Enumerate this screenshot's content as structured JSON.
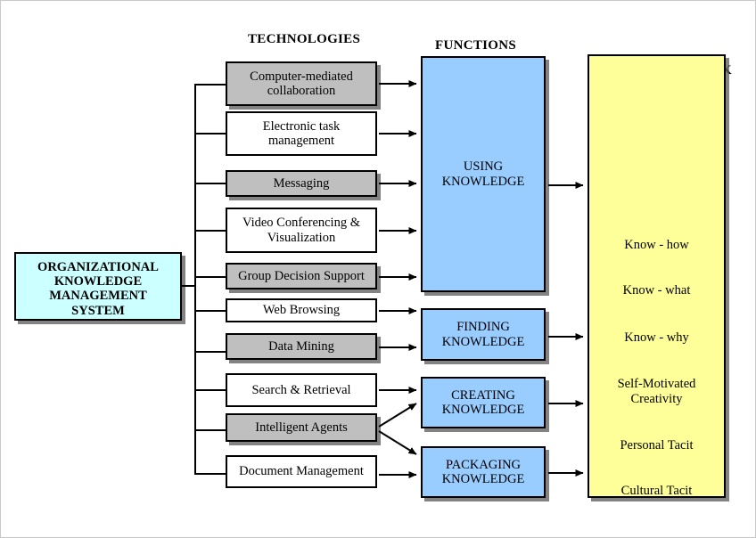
{
  "headers": {
    "technologies": "TECHNOLOGIES",
    "functions": "FUNCTIONS",
    "outcomes_clipped": "K"
  },
  "source": {
    "label_lines": [
      "ORGANIZATIONAL",
      "KNOWLEDGE",
      "MANAGEMENT",
      "SYSTEM"
    ],
    "note_last_line_clipped": "SYSTEM"
  },
  "technologies": [
    {
      "label": "Computer-mediated collaboration",
      "line1": "Computer-mediated",
      "line2": "collaboration",
      "style": "gray"
    },
    {
      "label": "Electronic task management",
      "line1": "Electronic task",
      "line2": "management",
      "style": "white"
    },
    {
      "label": "Messaging",
      "line1": "Messaging",
      "line2": "",
      "style": "gray"
    },
    {
      "label": "Video Conferencing & Visualization",
      "line1": "Video Conferencing &",
      "line2": "Visualization",
      "style": "white"
    },
    {
      "label": "Group Decision Support",
      "line1": "Group Decision Support",
      "line2": "",
      "style": "gray"
    },
    {
      "label": "Web Browsing",
      "line1": "Web Browsing",
      "line2": "",
      "style": "white"
    },
    {
      "label": "Data Mining",
      "line1": "Data Mining",
      "line2": "",
      "style": "gray"
    },
    {
      "label": "Search & Retrieval",
      "line1": "Search & Retrieval",
      "line2": "",
      "style": "white"
    },
    {
      "label": "Intelligent Agents",
      "line1": "Intelligent Agents",
      "line2": "",
      "style": "gray"
    },
    {
      "label": "Document Management",
      "line1": "Document Management",
      "line2": "",
      "style": "white"
    }
  ],
  "functions": [
    {
      "label": "USING KNOWLEDGE",
      "line1": "USING",
      "line2": "KNOWLEDGE"
    },
    {
      "label": "FINDING KNOWLEDGE",
      "line1": "FINDING",
      "line2": "KNOWLEDGE"
    },
    {
      "label": "CREATING KNOWLEDGE",
      "line1": "CREATING",
      "line2": "KNOWLEDGE"
    },
    {
      "label": "PACKAGING KNOWLEDGE",
      "line1": "PACKAGING",
      "line2": "KNOWLEDGE"
    }
  ],
  "outcomes": [
    "Know - how",
    "Know - what",
    "Know - why",
    "Self-Motivated",
    "Creativity",
    "Personal Tacit",
    "Cultural Tacit"
  ],
  "colors": {
    "source_box": "#CCFFFF",
    "tech_gray": "#BFBFBF",
    "tech_white": "#FFFFFF",
    "function_blue": "#99CCFF",
    "outcome_yellow": "#FFFF99",
    "line": "#000000",
    "shadow": "#5A5A5A"
  }
}
